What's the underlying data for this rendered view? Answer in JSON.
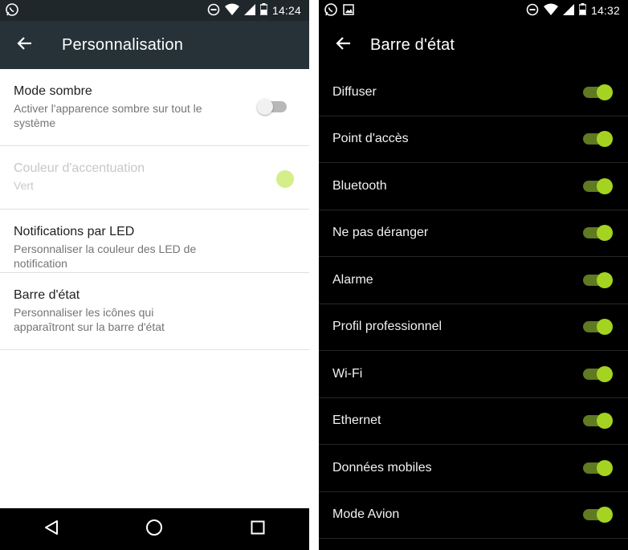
{
  "colors": {
    "toolbar_left": "#263238",
    "statusbar_left": "#1f272b",
    "accent": "#a4d421",
    "accent_track": "#5f7a20",
    "accent_disabled_dot": "#d4ee8a",
    "dark_bg": "#000000"
  },
  "left": {
    "status": {
      "time": "14:24",
      "icons": [
        "whatsapp-icon",
        "dnd-icon",
        "wifi-icon",
        "cellular-icon",
        "battery-icon"
      ]
    },
    "toolbar": {
      "title": "Personnalisation",
      "back_icon": "arrow-back-icon"
    },
    "settings": [
      {
        "title": "Mode sombre",
        "summary": "Activer l'apparence sombre sur tout le système",
        "control": "switch",
        "checked": false,
        "enabled": true
      },
      {
        "title": "Couleur d'accentuation",
        "summary": "Vert",
        "control": "color-dot",
        "enabled": false
      },
      {
        "title": "Notifications par LED",
        "summary": "Personnaliser la couleur des LED de notification",
        "enabled": true
      },
      {
        "title": "Barre d'état",
        "summary": "Personnaliser les icônes qui apparaîtront sur la barre d'état",
        "enabled": true
      }
    ],
    "navbar": [
      "back-triangle-icon",
      "home-circle-icon",
      "recents-square-icon"
    ]
  },
  "right": {
    "status": {
      "time": "14:32",
      "icons": [
        "whatsapp-icon",
        "image-icon",
        "dnd-icon",
        "wifi-icon",
        "cellular-icon",
        "battery-icon"
      ]
    },
    "toolbar": {
      "title": "Barre d'état",
      "back_icon": "arrow-back-icon"
    },
    "toggles": [
      {
        "label": "Diffuser",
        "checked": true
      },
      {
        "label": "Point d'accès",
        "checked": true
      },
      {
        "label": "Bluetooth",
        "checked": true
      },
      {
        "label": "Ne pas déranger",
        "checked": true
      },
      {
        "label": "Alarme",
        "checked": true
      },
      {
        "label": "Profil professionnel",
        "checked": true
      },
      {
        "label": "Wi-Fi",
        "checked": true
      },
      {
        "label": "Ethernet",
        "checked": true
      },
      {
        "label": "Données mobiles",
        "checked": true
      },
      {
        "label": "Mode Avion",
        "checked": true
      }
    ]
  }
}
